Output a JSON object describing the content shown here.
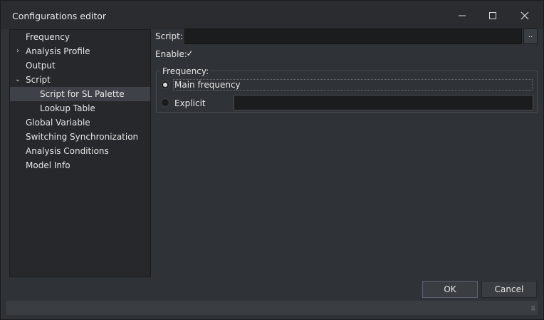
{
  "window": {
    "title": "Configurations editor"
  },
  "titlebar_icons": {
    "minimize": "minimize-icon",
    "maximize": "maximize-icon",
    "close": "close-icon"
  },
  "tree": {
    "items": [
      {
        "label": "Frequency",
        "level": 0,
        "expander": "",
        "selected": false
      },
      {
        "label": "Analysis Profile",
        "level": 0,
        "expander": "›",
        "selected": false
      },
      {
        "label": "Output",
        "level": 0,
        "expander": "",
        "selected": false
      },
      {
        "label": "Script",
        "level": 0,
        "expander": "⌄",
        "selected": false
      },
      {
        "label": "Script for SL Palette",
        "level": 1,
        "expander": "",
        "selected": true
      },
      {
        "label": "Lookup Table",
        "level": 1,
        "expander": "",
        "selected": false
      },
      {
        "label": "Global Variable",
        "level": 0,
        "expander": "",
        "selected": false
      },
      {
        "label": "Switching Synchronization",
        "level": 0,
        "expander": "",
        "selected": false
      },
      {
        "label": "Analysis Conditions",
        "level": 0,
        "expander": "",
        "selected": false
      },
      {
        "label": "Model Info",
        "level": 0,
        "expander": "",
        "selected": false
      }
    ]
  },
  "form": {
    "script_label": "Script:",
    "script_value": "",
    "browse_label": "..",
    "enable_label": "Enable:",
    "enable_checked": true,
    "check_glyph": "✓",
    "frequency_group_title": "Frequency:",
    "main_frequency_label": "Main frequency",
    "main_frequency_selected": true,
    "explicit_label": "Explicit",
    "explicit_value": ""
  },
  "buttons": {
    "ok": "OK",
    "cancel": "Cancel"
  },
  "statusbar": {
    "grip": "⠿"
  }
}
